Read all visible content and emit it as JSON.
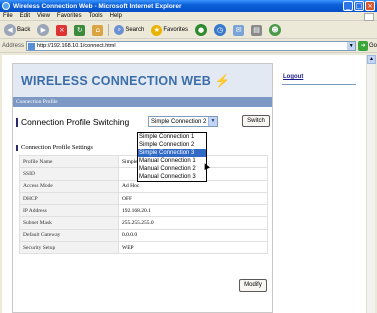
{
  "window": {
    "title": "Wireless Connection Web - Microsoft Internet Explorer",
    "min_glyph": "_",
    "max_glyph": "□",
    "close_glyph": "×"
  },
  "menu": [
    "File",
    "Edit",
    "View",
    "Favorites",
    "Tools",
    "Help"
  ],
  "toolbar": {
    "back_label": "Back",
    "search_label": "Search",
    "favorites_label": "Favorites"
  },
  "address": {
    "label": "Address",
    "url": "http://192.168.10.1/connect.html",
    "go_label": "Go"
  },
  "page": {
    "logo_text": "WIRELESS CONNECTION WEB",
    "logout_label": "Logout",
    "section_title": "Connection Profile",
    "switch_label": "Connection Profile Switching",
    "select_value": "Simple Connection 2",
    "switch_button": "Switch",
    "dropdown_options": [
      "Simple Connection 1",
      "Simple Connection 2",
      "Simple Connection 3",
      "Manual Connection 1",
      "Manual Connection 2",
      "Manual Connection 3"
    ],
    "dropdown_selected_index": 2,
    "settings_title": "Connection Profile Settings",
    "settings": [
      {
        "key": "Profile Name",
        "value": "Simple Connection 2 (Sample0)"
      },
      {
        "key": "SSID",
        "value": ""
      },
      {
        "key": "Access Mode",
        "value": "Ad Hoc"
      },
      {
        "key": "DHCP",
        "value": "OFF"
      },
      {
        "key": "IP Address",
        "value": "192.168.20.1"
      },
      {
        "key": "Subnet Mask",
        "value": "255.255.255.0"
      },
      {
        "key": "Default Gateway",
        "value": "0.0.0.0"
      },
      {
        "key": "Security Setup",
        "value": "WEP"
      }
    ],
    "modify_button": "Modify"
  }
}
